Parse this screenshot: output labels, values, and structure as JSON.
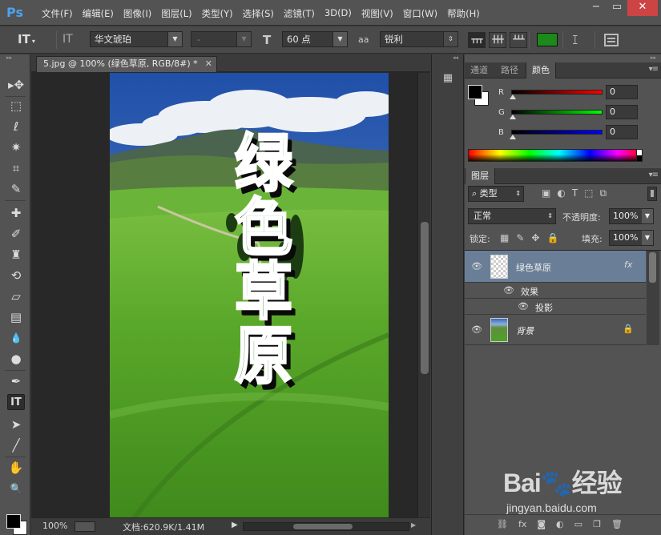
{
  "app": {
    "logo": "Ps",
    "menu": [
      "文件(F)",
      "编辑(E)",
      "图像(I)",
      "图层(L)",
      "类型(Y)",
      "选择(S)",
      "滤镜(T)",
      "3D(D)",
      "视图(V)",
      "窗口(W)",
      "帮助(H)"
    ],
    "window_controls": {
      "minimize": "−",
      "restore": "▭",
      "close": "✕"
    }
  },
  "options": {
    "tool_icon": "IT",
    "orient_icon": "IT",
    "font_family": "华文琥珀",
    "font_style": "-",
    "size_icon": "T",
    "font_size": "60 点",
    "aa_icon": "aa",
    "antialias": "锐利",
    "text_color": "#1b8a1b",
    "warp_icon": "warp-text-icon",
    "align_buttons": [
      "align-top",
      "align-center",
      "align-bottom"
    ]
  },
  "tools": [
    {
      "name": "move-tool-icon",
      "glyph": "▸✥"
    },
    {
      "name": "marquee-tool-icon",
      "glyph": "⬚"
    },
    {
      "name": "lasso-tool-icon",
      "glyph": "ℓ"
    },
    {
      "name": "magic-wand-tool-icon",
      "glyph": "✷"
    },
    {
      "name": "crop-tool-icon",
      "glyph": "⌗"
    },
    {
      "name": "eyedropper-tool-icon",
      "glyph": "✎"
    },
    {
      "name": "healing-brush-tool-icon",
      "glyph": "✚"
    },
    {
      "name": "brush-tool-icon",
      "glyph": "✐"
    },
    {
      "name": "clone-stamp-tool-icon",
      "glyph": "♜"
    },
    {
      "name": "history-brush-tool-icon",
      "glyph": "⟲"
    },
    {
      "name": "eraser-tool-icon",
      "glyph": "▱"
    },
    {
      "name": "gradient-tool-icon",
      "glyph": "▤"
    },
    {
      "name": "blur-tool-icon",
      "glyph": "💧"
    },
    {
      "name": "dodge-tool-icon",
      "glyph": "●"
    },
    {
      "name": "pen-tool-icon",
      "glyph": "✒"
    },
    {
      "name": "type-tool-icon",
      "glyph": "IT"
    },
    {
      "name": "path-selection-tool-icon",
      "glyph": "➤"
    },
    {
      "name": "line-tool-icon",
      "glyph": "╱"
    },
    {
      "name": "hand-tool-icon",
      "glyph": "✋"
    },
    {
      "name": "zoom-tool-icon",
      "glyph": "🔍"
    }
  ],
  "document": {
    "tab_title": "5.jpg @ 100% (绿色草原, RGB/8#) *",
    "vertical_text": [
      "绿",
      "色",
      "草",
      "原"
    ],
    "zoom": "100%",
    "doc_info": "文档:620.9K/1.41M"
  },
  "color_panel": {
    "tabs": [
      "通道",
      "路径",
      "颜色"
    ],
    "active_tab": "颜色",
    "channels": [
      {
        "label": "R",
        "value": "0",
        "gradient": "linear-gradient(to right,#000,#f00)"
      },
      {
        "label": "G",
        "value": "0",
        "gradient": "linear-gradient(to right,#000,#0f0)"
      },
      {
        "label": "B",
        "value": "0",
        "gradient": "linear-gradient(to right,#000,#00f)"
      }
    ],
    "foreground": "#000000",
    "background": "#ffffff"
  },
  "layers_panel": {
    "tab": "图层",
    "filter": "类型",
    "blend_mode": "正常",
    "opacity_label": "不透明度:",
    "opacity": "100%",
    "lock_label": "锁定:",
    "fill_label": "填充:",
    "fill": "100%",
    "layers": [
      {
        "name": "绿色草原",
        "type": "text",
        "fx": "fx",
        "selected": true
      },
      {
        "name": "效果",
        "type": "effect-group"
      },
      {
        "name": "投影",
        "type": "effect"
      },
      {
        "name": "背景",
        "type": "image",
        "locked": true
      }
    ]
  },
  "watermark": {
    "logo": "Bai🐾经验",
    "url": "jingyan.baidu.com"
  }
}
